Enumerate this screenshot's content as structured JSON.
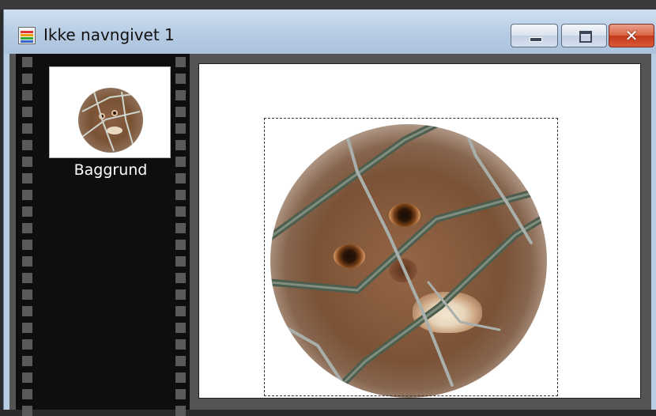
{
  "window": {
    "title": "Ikke navngivet 1",
    "icon": "film-document-icon",
    "controls": {
      "minimize": "minimize-icon",
      "maximize": "maximize-icon",
      "close_glyph": "✕"
    }
  },
  "layers": {
    "items": [
      {
        "label": "Baggrund",
        "thumbnail": "monkey-vignette-thumbnail"
      }
    ]
  },
  "canvas": {
    "image": "monkey-behind-fence-vignette",
    "selection": "dashed-selection-marquee"
  },
  "colors": {
    "titlebar": "#b7cce3",
    "filmstrip": "#0e0e0e",
    "close_button": "#c3391a",
    "canvas_bg": "#ffffff"
  }
}
